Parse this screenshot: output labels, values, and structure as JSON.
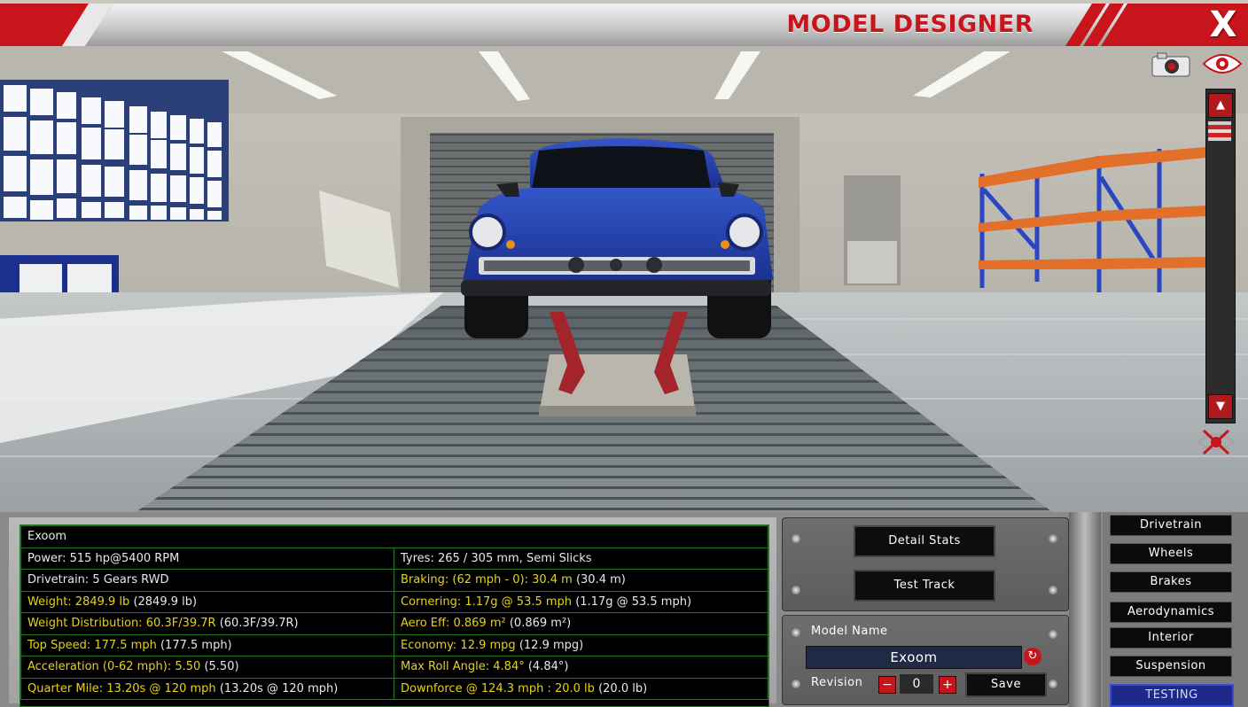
{
  "header": {
    "title": "MODEL DESIGNER",
    "close_label": "X"
  },
  "icons": {
    "camera": "camera-icon",
    "view": "eye-icon",
    "hide_view": "eye-crossed-icon"
  },
  "colors": {
    "accent_red": "#c8151c",
    "stat_highlight": "#e4d21f",
    "grid_green": "#1d7a1d",
    "car_blue": "#1f3fa8"
  },
  "stats": {
    "model_name": "Exoom",
    "rows": [
      {
        "left": "Power: 515 hp@5400 RPM",
        "left_extra": "",
        "left_hl": false,
        "right": "Tyres: 265 / 305 mm, Semi Slicks",
        "right_extra": "",
        "right_hl": false
      },
      {
        "left": "Drivetrain: 5 Gears RWD",
        "left_extra": "",
        "left_hl": false,
        "right": "Braking: (62 mph - 0): 30.4 m",
        "right_extra": "(30.4 m)",
        "right_hl": true
      },
      {
        "left": "Weight: 2849.9 lb",
        "left_extra": "(2849.9 lb)",
        "left_hl": true,
        "right": "Cornering: 1.17g @ 53.5 mph",
        "right_extra": "(1.17g @ 53.5 mph)",
        "right_hl": true
      },
      {
        "left": "Weight Distribution: 60.3F/39.7R",
        "left_extra": "(60.3F/39.7R)",
        "left_hl": true,
        "right": "Aero Eff: 0.869 m²",
        "right_extra": "(0.869 m²)",
        "right_hl": true
      },
      {
        "left": "Top Speed: 177.5 mph",
        "left_extra": "(177.5 mph)",
        "left_hl": true,
        "right": "Economy: 12.9 mpg",
        "right_extra": "(12.9 mpg)",
        "right_hl": true
      },
      {
        "left": "Acceleration (0-62 mph): 5.50",
        "left_extra": "(5.50)",
        "left_hl": true,
        "right": "Max Roll Angle: 4.84°",
        "right_extra": "(4.84°)",
        "right_hl": true
      },
      {
        "left": "Quarter Mile: 13.20s @ 120 mph",
        "left_extra": "(13.20s @ 120 mph)",
        "left_hl": true,
        "right": "Downforce @ 124.3 mph : 20.0 lb",
        "right_extra": "(20.0 lb)",
        "right_hl": true
      }
    ]
  },
  "controls": {
    "detail_stats": "Detail Stats",
    "test_track": "Test Track",
    "model_name_label": "Model Name",
    "model_name_value": "Exoom",
    "revision_label": "Revision",
    "revision_value": "0",
    "minus": "−",
    "plus": "+",
    "save": "Save"
  },
  "nav": [
    {
      "label": "Drivetrain",
      "active": false
    },
    {
      "label": "Wheels",
      "active": false
    },
    {
      "label": "Brakes",
      "active": false
    },
    {
      "label": "Aerodynamics",
      "active": false
    },
    {
      "label": "Interior",
      "active": false
    },
    {
      "label": "Suspension",
      "active": false
    },
    {
      "label": "TESTING",
      "active": true
    }
  ]
}
